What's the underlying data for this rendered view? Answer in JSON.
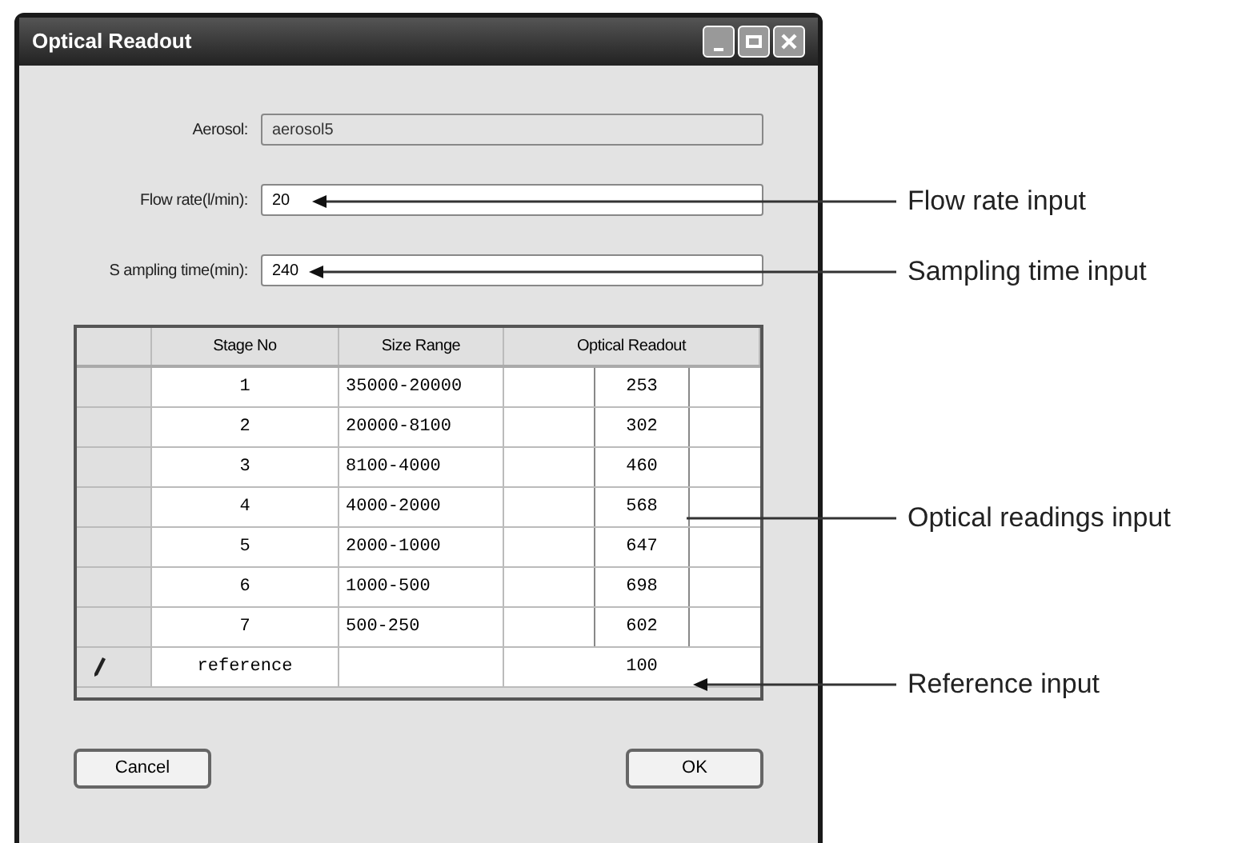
{
  "window": {
    "title": "Optical Readout"
  },
  "fields": [
    {
      "label": "Aerosol:",
      "value": "aerosol5",
      "disabled": true
    },
    {
      "label": "Flow rate(l/min):",
      "value": "20",
      "disabled": false
    },
    {
      "label": "S ampling time(min):",
      "value": "240",
      "disabled": false
    }
  ],
  "table": {
    "columns": [
      "Stage No",
      "Size Range",
      "Optical Readout"
    ],
    "rows": [
      {
        "cells": [
          "1",
          "35000-20000",
          "253"
        ],
        "editing": false
      },
      {
        "cells": [
          "2",
          "20000-8100",
          "302"
        ],
        "editing": false
      },
      {
        "cells": [
          "3",
          "8100-4000",
          "460"
        ],
        "editing": false
      },
      {
        "cells": [
          "4",
          "4000-2000",
          "568"
        ],
        "editing": false
      },
      {
        "cells": [
          "5",
          "2000-1000",
          "647"
        ],
        "editing": false
      },
      {
        "cells": [
          "6",
          "1000-500",
          "698"
        ],
        "editing": false
      },
      {
        "cells": [
          "7",
          "500-250",
          "602"
        ],
        "editing": false
      },
      {
        "cells": [
          "reference",
          "",
          "100"
        ],
        "editing": true
      }
    ]
  },
  "buttons": [
    "Cancel",
    "OK"
  ],
  "annotations": [
    {
      "text": "Flow rate input",
      "kind": "arrow"
    },
    {
      "text": "Sampling time input",
      "kind": "arrow"
    },
    {
      "text": "Optical readings input",
      "kind": "line"
    },
    {
      "text": "Reference input",
      "kind": "arrow"
    }
  ]
}
